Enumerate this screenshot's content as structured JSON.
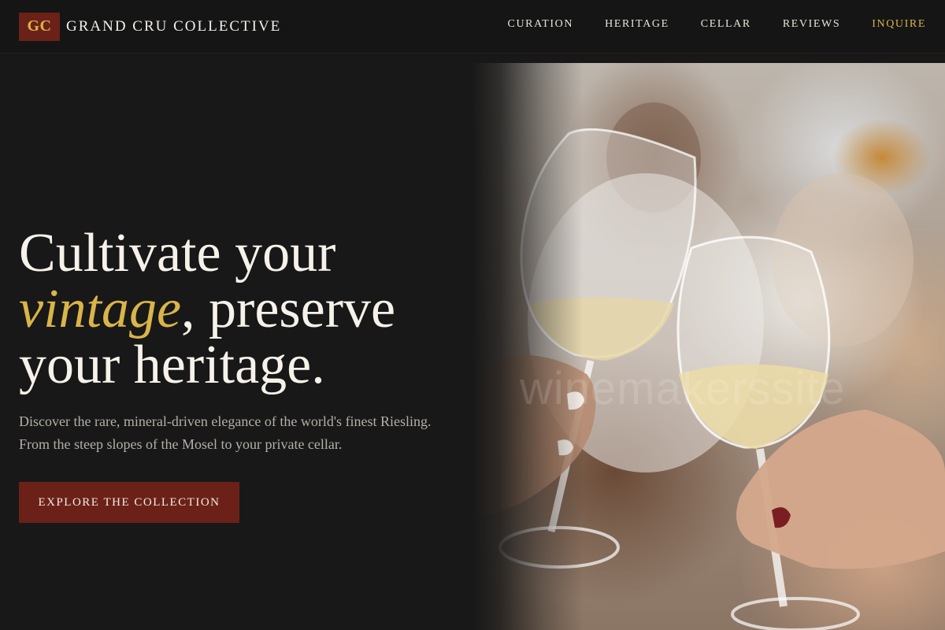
{
  "brand": {
    "logo_text": "GC",
    "name": "GRAND CRU COLLECTIVE"
  },
  "nav": {
    "items": [
      {
        "label": "CURATION"
      },
      {
        "label": "HERITAGE"
      },
      {
        "label": "CELLAR"
      },
      {
        "label": "REVIEWS"
      },
      {
        "label": "INQUIRE",
        "accent": true
      }
    ]
  },
  "hero": {
    "headline_line1": "Cultivate your",
    "headline_emphasis": "vintage",
    "headline_line2_rest": ", preserve",
    "headline_line3": "your heritage.",
    "lede_line1": "Discover the rare, mineral-driven elegance of the world's finest Riesling.",
    "lede_line2": "From the steep slopes of the Mosel to your private cellar.",
    "cta_label": "EXPLORE THE COLLECTION",
    "image_watermark": "winemakerssite"
  },
  "colors": {
    "background": "#181818",
    "header": "#151515",
    "accent_gold": "#d9b44a",
    "brand_red": "#6b2118",
    "text_muted": "#b4afa8"
  },
  "icons": {
    "hero_image": "wine-glasses-toast-photo"
  }
}
